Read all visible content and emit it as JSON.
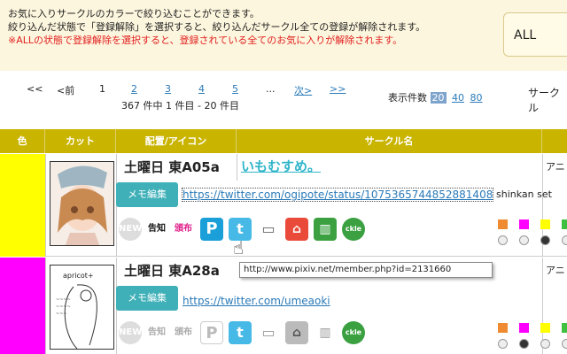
{
  "notice": {
    "line1": "お気に入りサークルのカラーで絞り込むことができます。",
    "line2": "絞り込んだ状態で「登録解除」を選択すると、絞り込んだサークル全ての登録が解除されます。",
    "line3": "※ALLの状態で登録解除を選択すると、登録されている全てのお気に入りが解除されます。"
  },
  "filter": {
    "value": "ALL"
  },
  "pager": {
    "first": "<<",
    "prev": "<前",
    "current": "1",
    "pages": [
      "2",
      "3",
      "4",
      "5"
    ],
    "ellipsis": "...",
    "next": "次>",
    "last": ">>",
    "count": "367 件中 1 件目 - 20 件目"
  },
  "perpage": {
    "label": "表示件数",
    "selected": "20",
    "opt40": "40",
    "opt80": "80"
  },
  "circle_label": "サークル",
  "table": {
    "col_color": "色",
    "col_cut": "カット",
    "col_place": "配置/アイコン",
    "col_name": "サークル名"
  },
  "rows": [
    {
      "color": "#ffff00",
      "place": "土曜日 東A05a",
      "name": "いもむすめ。",
      "genre": "アニ",
      "memo": "メモ編集",
      "link": "https://twitter.com/ogipote/status/1075365744852881408",
      "note": "shinkan set"
    },
    {
      "color": "#ff00ff",
      "place": "土曜日 東A28a",
      "name": "",
      "genre": "アニ",
      "memo": "メモ編集",
      "link": "https://twitter.com/umeaoki",
      "note": ""
    }
  ],
  "icons": {
    "new": "NEW",
    "kokuchi": "告知",
    "hanpu": "頒布"
  },
  "tooltip": "http://www.pixiv.net/member.php?id=2131660",
  "palette": [
    "#f08a30",
    "#ff00ff",
    "#ffff00",
    "#40c040"
  ]
}
